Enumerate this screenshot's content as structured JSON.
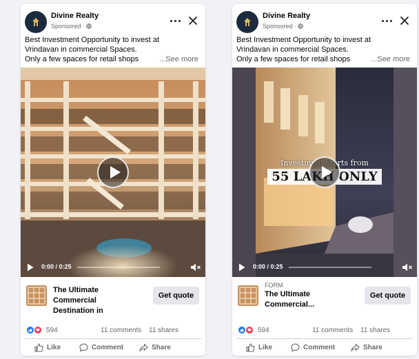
{
  "colors": {
    "brand_blue": "#1877f2",
    "love_red": "#f33e58",
    "muted": "#65676b",
    "button_bg": "#e4e6eb"
  },
  "ads": [
    {
      "page_name": "Divine Realty",
      "sponsored": "Sponsored ·",
      "text_lines": [
        "Best Investment Opportunity to invest at",
        "Vrindavan in commercial Spaces.",
        "Only a few spaces for retail shops"
      ],
      "see_more": "...See more",
      "video_time": "0:00 / 0:25",
      "video_progress": 0,
      "cta_kicker": "",
      "cta_title": "The Ultimate Commercial Destination in",
      "cta_button": "Get quote",
      "reactions_count": "594",
      "comments": "11 comments",
      "shares": "11 shares",
      "actions": {
        "like": "Like",
        "comment": "Comment",
        "share": "Share"
      },
      "icons": [
        "more-icon",
        "close-icon",
        "globe-icon",
        "play-icon",
        "volume-muted-icon",
        "like-reaction-icon",
        "love-reaction-icon",
        "thumbs-up-icon",
        "comment-icon",
        "share-icon"
      ]
    },
    {
      "page_name": "Divine Realty",
      "sponsored": "Sponsored ·",
      "text_lines": [
        "Best Investment Opportunity to invest at",
        "Vrindavan in commercial Spaces.",
        "Only a few spaces for retail shops"
      ],
      "see_more": "...See more",
      "video_overlay_line1": "Investment starts from",
      "video_overlay_line2": "55 LAKH ONLY",
      "video_time": "0:00 / 0:25",
      "video_progress": 0,
      "cta_kicker": "FORM",
      "cta_title": "The Ultimate Commercial...",
      "cta_button": "Get quote",
      "reactions_count": "594",
      "comments": "11 comments",
      "shares": "11 shares",
      "actions": {
        "like": "Like",
        "comment": "Comment",
        "share": "Share"
      },
      "icons": [
        "more-icon",
        "close-icon",
        "globe-icon",
        "play-icon",
        "volume-muted-icon",
        "like-reaction-icon",
        "love-reaction-icon",
        "thumbs-up-icon",
        "comment-icon",
        "share-icon"
      ]
    }
  ]
}
